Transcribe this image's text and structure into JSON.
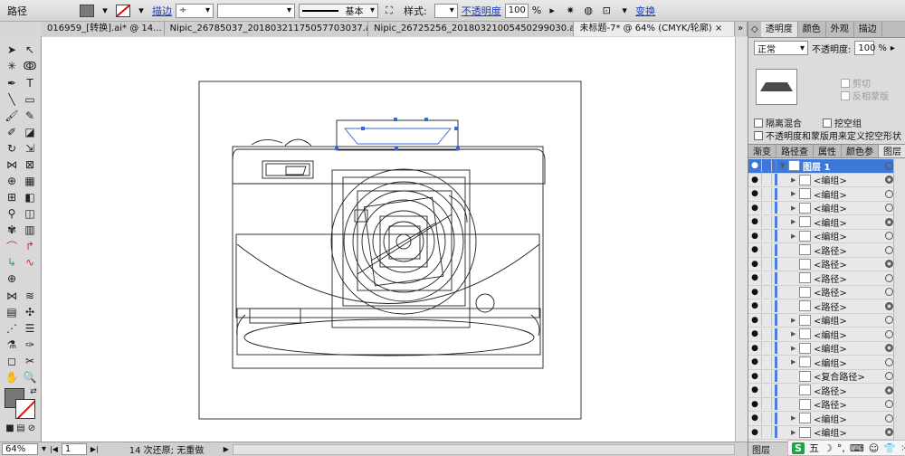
{
  "control_bar": {
    "object_type": "路径",
    "stroke_label": "描边",
    "stroke_profile": "基本",
    "style_label": "样式:",
    "opacity_label": "不透明度",
    "opacity_value": "100",
    "percent": "%",
    "transform_label": "变换"
  },
  "tabs": [
    "016959_[转换].ai* @ 14...",
    "Nipic_26785037_20180321175057703037.ai*",
    "Nipic_26725256_20180321005450299030.ai*",
    "未标题-7* @ 64% (CMYK/轮廓)"
  ],
  "transparency_panel": {
    "tabs": [
      "透明度",
      "颜色",
      "外观",
      "描边"
    ],
    "blend_mode": "正常",
    "opacity_label": "不透明度:",
    "opacity_value": "100",
    "percent": "%",
    "clip_label": "剪切",
    "invert_mask_label": "反相蒙版",
    "isolate_blending_label": "隔离混合",
    "knockout_group_label": "挖空组",
    "opacity_mask_label": "不透明度和蒙版用来定义挖空形状"
  },
  "layers_panel": {
    "tabs": [
      "渐变",
      "路径查",
      "属性",
      "颜色参",
      "图层"
    ],
    "rows": [
      {
        "name": "图层 1",
        "selected": true,
        "expand": true
      },
      {
        "name": "<编组>",
        "expand": true
      },
      {
        "name": "<编组>",
        "expand": true
      },
      {
        "name": "<编组>",
        "expand": true
      },
      {
        "name": "<编组>",
        "expand": true
      },
      {
        "name": "<编组>",
        "expand": true
      },
      {
        "name": "<路径>",
        "expand": false
      },
      {
        "name": "<路径>",
        "expand": false
      },
      {
        "name": "<路径>",
        "expand": false
      },
      {
        "name": "<路径>",
        "expand": false
      },
      {
        "name": "<路径>",
        "expand": false
      },
      {
        "name": "<编组>",
        "expand": true
      },
      {
        "name": "<编组>",
        "expand": true
      },
      {
        "name": "<编组>",
        "expand": true
      },
      {
        "name": "<编组>",
        "expand": true
      },
      {
        "name": "<复合路径>",
        "expand": false
      },
      {
        "name": "<路径>",
        "expand": false
      },
      {
        "name": "<路径>",
        "expand": false
      },
      {
        "name": "<编组>",
        "expand": true
      },
      {
        "name": "<编组>",
        "expand": true
      }
    ],
    "footer_label": "图层"
  },
  "status_bar": {
    "zoom": "64%",
    "artboard": "1",
    "history": "14 次还原; 无重做"
  },
  "ime": {
    "logo": "S",
    "mode": "五"
  }
}
